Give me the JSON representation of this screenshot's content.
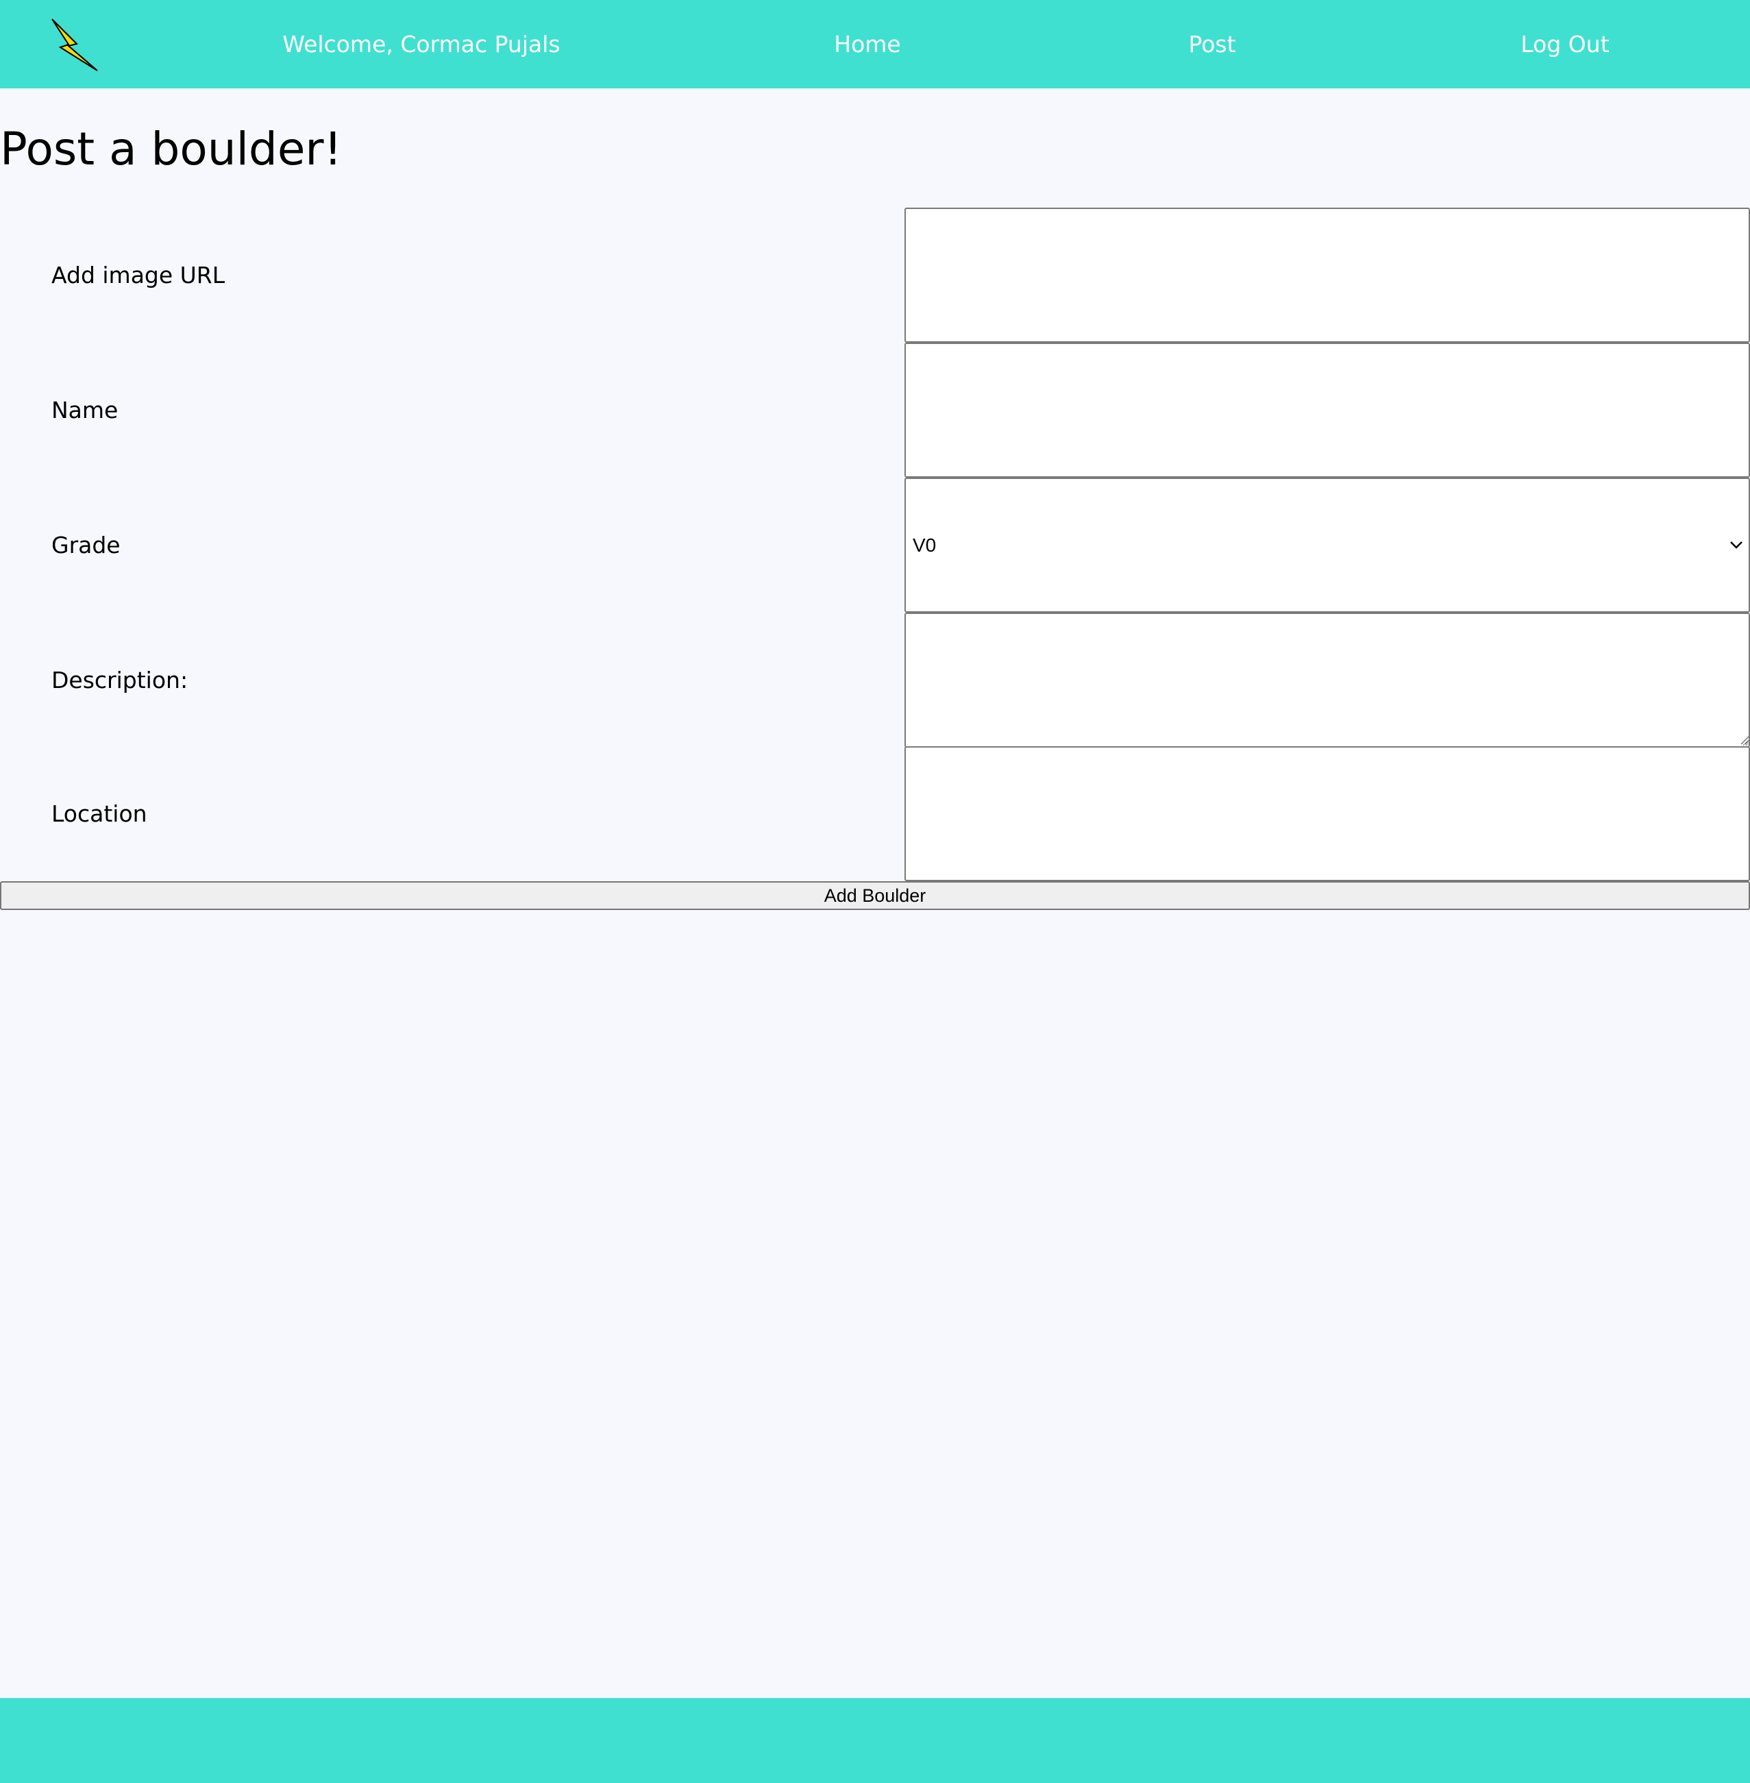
{
  "navbar": {
    "logo_icon": "lightning-bolt-icon",
    "welcome_text": "Welcome, Cormac Pujals",
    "links": {
      "home": "Home",
      "post": "Post",
      "logout": "Log Out"
    }
  },
  "page": {
    "title": "Post a boulder!"
  },
  "form": {
    "image_url": {
      "label": "Add image URL",
      "value": "",
      "placeholder": ""
    },
    "name": {
      "label": "Name",
      "value": "",
      "placeholder": ""
    },
    "grade": {
      "label": "Grade",
      "selected": "V0"
    },
    "description": {
      "label": "Description:",
      "value": ""
    },
    "location": {
      "label": "Location",
      "value": "",
      "placeholder": ""
    },
    "submit_label": "Add Boulder"
  },
  "colors": {
    "accent": "#40e0d0",
    "background": "#f7f8fd",
    "bolt": "#f5d90a"
  }
}
